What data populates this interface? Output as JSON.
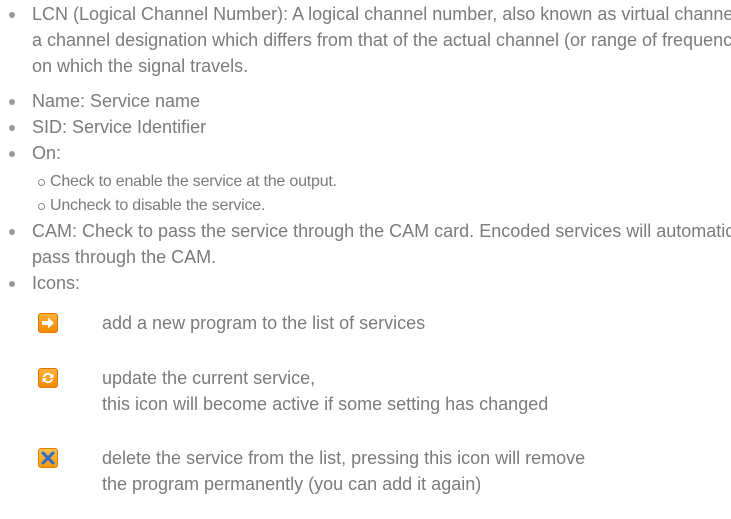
{
  "bullets": [
    {
      "text": "LCN (Logical Channel Number): A logical channel number, also known as virtual channel, is a channel designation which differs from that of the actual channel (or range of frequencies) on which the signal travels."
    },
    {
      "text": "Name: Service name"
    },
    {
      "text": "SID: Service Identifier"
    },
    {
      "text": "On:"
    },
    {
      "text": "CAM: Check to pass the service through the CAM card. Encoded services will automatically pass through the CAM."
    },
    {
      "text": "Icons:"
    }
  ],
  "on_subitems": [
    {
      "text": "Check to enable the service at the output."
    },
    {
      "text": "Uncheck to disable the service."
    }
  ],
  "icons": [
    {
      "icon": "arrow-right-icon",
      "line1": "add a new program to the list of services",
      "line2": ""
    },
    {
      "icon": "refresh-icon",
      "line1": "update the current service,",
      "line2": "this icon will become active if some setting has changed"
    },
    {
      "icon": "close-icon",
      "line1": "delete the service from the list, pressing this icon will remove",
      "line2": "the program permanently (you can add it again)"
    }
  ],
  "colors": {
    "text": "#7b7b7b",
    "icon_orange": "#f08a00",
    "delete_x": "#2f6ec8"
  }
}
